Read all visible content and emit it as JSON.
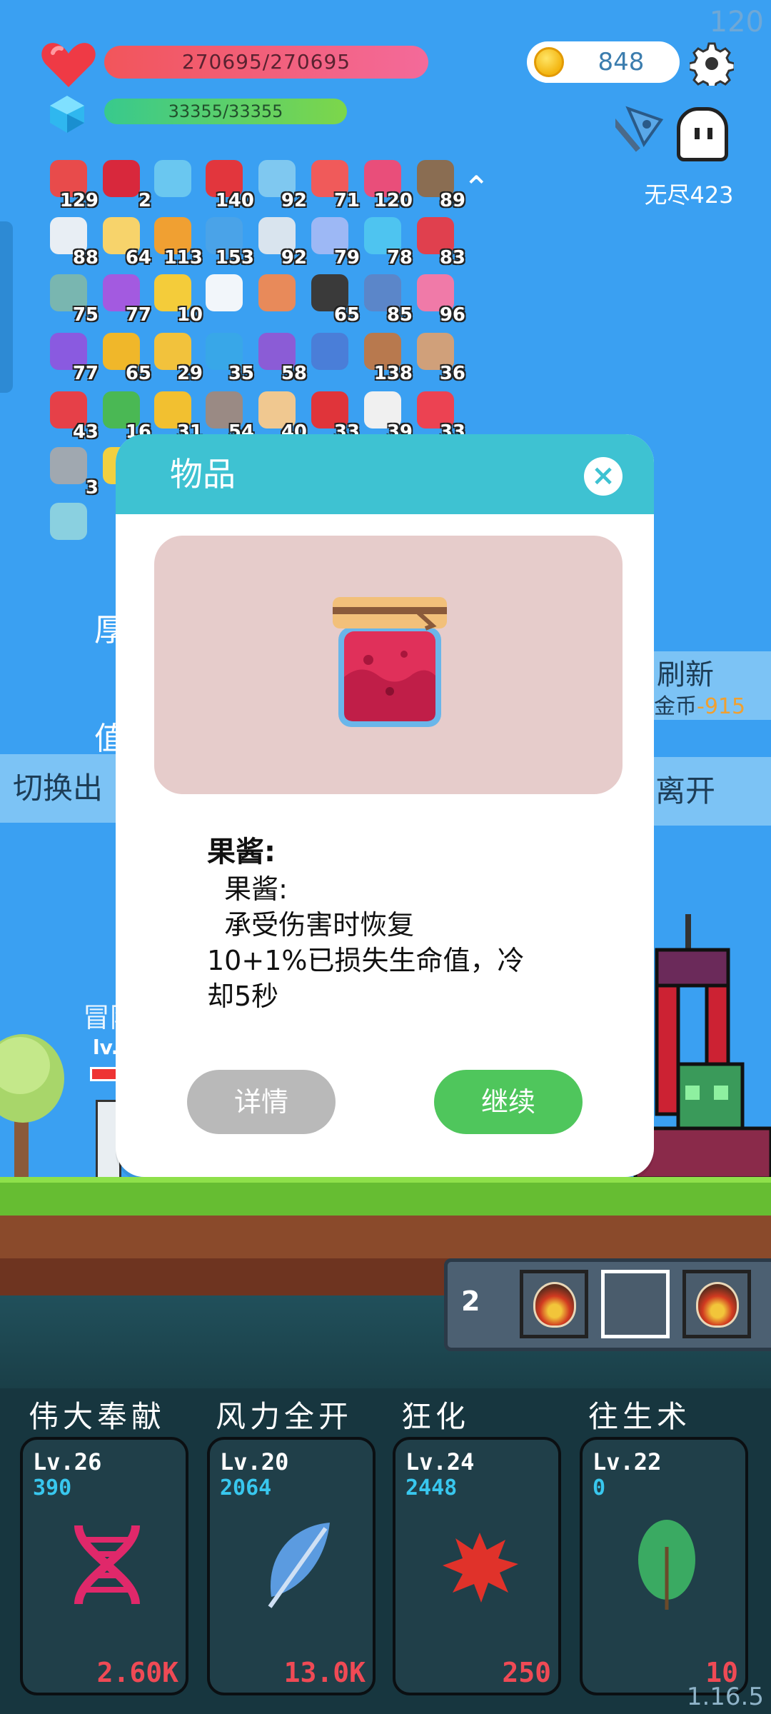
{
  "hud": {
    "fps": "120",
    "hp": "270695/270695",
    "mp": "33355/33355",
    "coins": "848",
    "mode": "无尽423",
    "version": "1.16.5"
  },
  "items": [
    {
      "count": "129",
      "color": "#e84b4b"
    },
    {
      "count": "2",
      "color": "#d8283c"
    },
    {
      "count": "",
      "color": "#6ac7f0"
    },
    {
      "count": "140",
      "color": "#e2363d"
    },
    {
      "count": "92",
      "color": "#7fc8f0"
    },
    {
      "count": "71",
      "color": "#f05a5a"
    },
    {
      "count": "120",
      "color": "#e94e7a"
    },
    {
      "count": "89",
      "color": "#8a6d52"
    },
    {
      "count": "88",
      "color": "#e8eef4"
    },
    {
      "count": "64",
      "color": "#f7d36b"
    },
    {
      "count": "113",
      "color": "#f0a032"
    },
    {
      "count": "153",
      "color": "#4aa3e8"
    },
    {
      "count": "92",
      "color": "#d9e4ee"
    },
    {
      "count": "79",
      "color": "#9db8f5"
    },
    {
      "count": "78",
      "color": "#4ec4f0"
    },
    {
      "count": "83",
      "color": "#e0404e"
    },
    {
      "count": "75",
      "color": "#79b6b0"
    },
    {
      "count": "77",
      "color": "#a35ae0"
    },
    {
      "count": "10",
      "color": "#f4cc3a"
    },
    {
      "count": "",
      "color": "#f2f6fa"
    },
    {
      "count": "",
      "color": "#e88a5a"
    },
    {
      "count": "65",
      "color": "#3a3a3a"
    },
    {
      "count": "85",
      "color": "#5b86c9"
    },
    {
      "count": "96",
      "color": "#f07aa8"
    },
    {
      "count": "77",
      "color": "#8a5ae0"
    },
    {
      "count": "65",
      "color": "#f0b72a"
    },
    {
      "count": "29",
      "color": "#f2c23c"
    },
    {
      "count": "35",
      "color": "#38a7e8"
    },
    {
      "count": "58",
      "color": "#8b5cd6"
    },
    {
      "count": "",
      "color": "#4a7ed8"
    },
    {
      "count": "138",
      "color": "#b8794e"
    },
    {
      "count": "36",
      "color": "#d0a07a"
    },
    {
      "count": "43",
      "color": "#e64048"
    },
    {
      "count": "16",
      "color": "#4ab854"
    },
    {
      "count": "31",
      "color": "#f2c030"
    },
    {
      "count": "54",
      "color": "#9a8a84"
    },
    {
      "count": "40",
      "color": "#f0c890"
    },
    {
      "count": "33",
      "color": "#e0343a"
    },
    {
      "count": "39",
      "color": "#f0f0f0"
    },
    {
      "count": "33",
      "color": "#ec4252"
    },
    {
      "count": "3",
      "color": "#a0a8b0"
    },
    {
      "count": "",
      "color": "#f2d040"
    },
    {
      "count": "",
      "color": "#8ad0e0"
    }
  ],
  "background_labels": {
    "left1": "厚",
    "left2": "值",
    "switch_btn": "切换出",
    "refresh_title": "刷新",
    "refresh_cost_prefix": "金币",
    "refresh_cost": "-915",
    "leave_btn": "离开",
    "hero_name": "冒险",
    "hero_lv": "lv."
  },
  "modal": {
    "title": "物品",
    "close_glyph": "×",
    "item_name": "果酱:",
    "description": "\t果酱:\n\t承受伤害时恢复\n10+1%已损失生命值，冷\n却5秒",
    "detail_button": "详情",
    "continue_button": "继续"
  },
  "potion_bar": {
    "count": "2"
  },
  "skills": [
    {
      "name": "伟大奉献",
      "level": "Lv.26",
      "points": "390",
      "cost": "2.60K",
      "icon": "dna-icon",
      "color": "#e0286a"
    },
    {
      "name": "风力全开",
      "level": "Lv.20",
      "points": "2064",
      "cost": "13.0K",
      "icon": "feather-icon",
      "color": "#5b9be0"
    },
    {
      "name": "狂化",
      "level": "Lv.24",
      "points": "2448",
      "cost": "250",
      "icon": "splat-icon",
      "color": "#e0322a"
    },
    {
      "name": "往生术",
      "level": "Lv.22",
      "points": "0",
      "cost": "10",
      "icon": "leaf-icon",
      "color": "#3aaa62"
    }
  ]
}
